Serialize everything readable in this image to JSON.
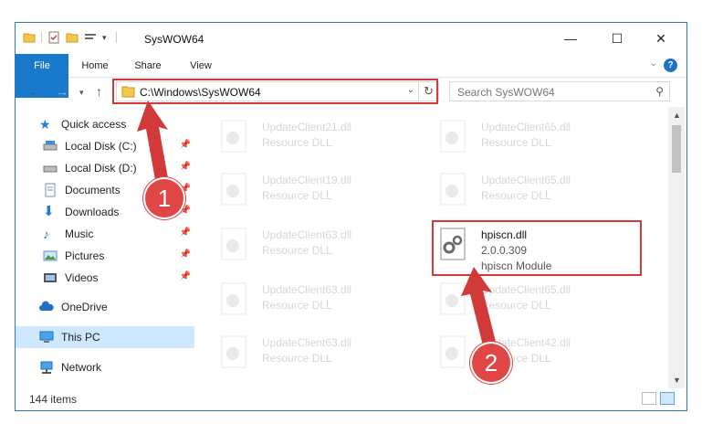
{
  "window": {
    "title": "SysWOW64",
    "minimize": "—",
    "maximize": "☐",
    "close": "✕"
  },
  "ribbon": {
    "tabs": [
      "File",
      "Home",
      "Share",
      "View"
    ]
  },
  "navigation": {
    "address": "C:\\Windows\\SysWOW64",
    "search_placeholder": "Search SysWOW64"
  },
  "sidebar": {
    "items": [
      {
        "label": "Quick access",
        "icon": "star-icon"
      },
      {
        "label": "Local Disk (C:)",
        "icon": "drive-icon",
        "pinned": true
      },
      {
        "label": "Local Disk (D:)",
        "icon": "drive-icon",
        "pinned": true
      },
      {
        "label": "Documents",
        "icon": "documents-icon",
        "pinned": true
      },
      {
        "label": "Downloads",
        "icon": "download-icon",
        "pinned": true
      },
      {
        "label": "Music",
        "icon": "music-icon",
        "pinned": true
      },
      {
        "label": "Pictures",
        "icon": "pictures-icon",
        "pinned": true
      },
      {
        "label": "Videos",
        "icon": "videos-icon",
        "pinned": true
      },
      {
        "label": "OneDrive",
        "icon": "cloud-icon"
      },
      {
        "label": "This PC",
        "icon": "computer-icon",
        "selected": true
      },
      {
        "label": "Network",
        "icon": "network-icon"
      }
    ]
  },
  "files": [
    {
      "name": "UpdateClient21.dll",
      "desc": "Resource DLL"
    },
    {
      "name": "UpdateClient65.dll",
      "desc": "Resource DLL"
    },
    {
      "name": "UpdateClient19.dll",
      "desc": "Resource DLL"
    },
    {
      "name": "UpdateClient65.dll",
      "desc": "Resource DLL"
    },
    {
      "name": "UpdateClient63.dll",
      "desc": "Resource DLL"
    },
    {
      "name": "hpiscn.dll",
      "desc": "2.0.0.309",
      "desc2": "hpiscn Module"
    },
    {
      "name": "UpdateClient63.dll",
      "desc": "Resource DLL"
    },
    {
      "name": "UpdateClient65.dll",
      "desc": "Resource DLL"
    },
    {
      "name": "UpdateClient63.dll",
      "desc": "Resource DLL"
    },
    {
      "name": "UpdateClient42.dll",
      "desc": "Resource DLL"
    }
  ],
  "status": {
    "item_count": "144 items"
  },
  "annotations": {
    "step1": "1",
    "step2": "2",
    "color": "#d23a3a"
  }
}
